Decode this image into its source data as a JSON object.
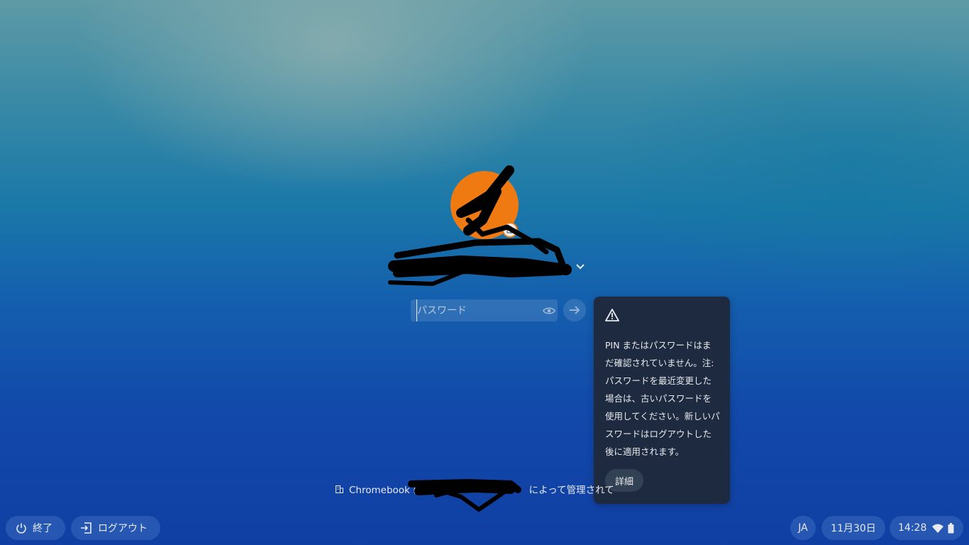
{
  "login": {
    "password_placeholder": "パスワード",
    "avatar_color": "#ef7a12"
  },
  "warning_bubble": {
    "icon": "warning-icon",
    "message": "PIN またはパスワードはまだ確認されていません。注: パスワードを最近変更した場合は、古いパスワードを使用してください。新しいパスワードはログアウトした後に適用されます。",
    "details_label": "詳細"
  },
  "managed_notice": {
    "prefix": "Chromebook は",
    "suffix": "によって管理されて"
  },
  "shelf": {
    "shutdown_label": "終了",
    "logout_label": "ログアウト",
    "ime_label": "JA",
    "date_label": "11月30日",
    "time_label": "14:28"
  },
  "colors": {
    "bubble_bg": "#1d2a40",
    "text": "#e8eaed"
  }
}
